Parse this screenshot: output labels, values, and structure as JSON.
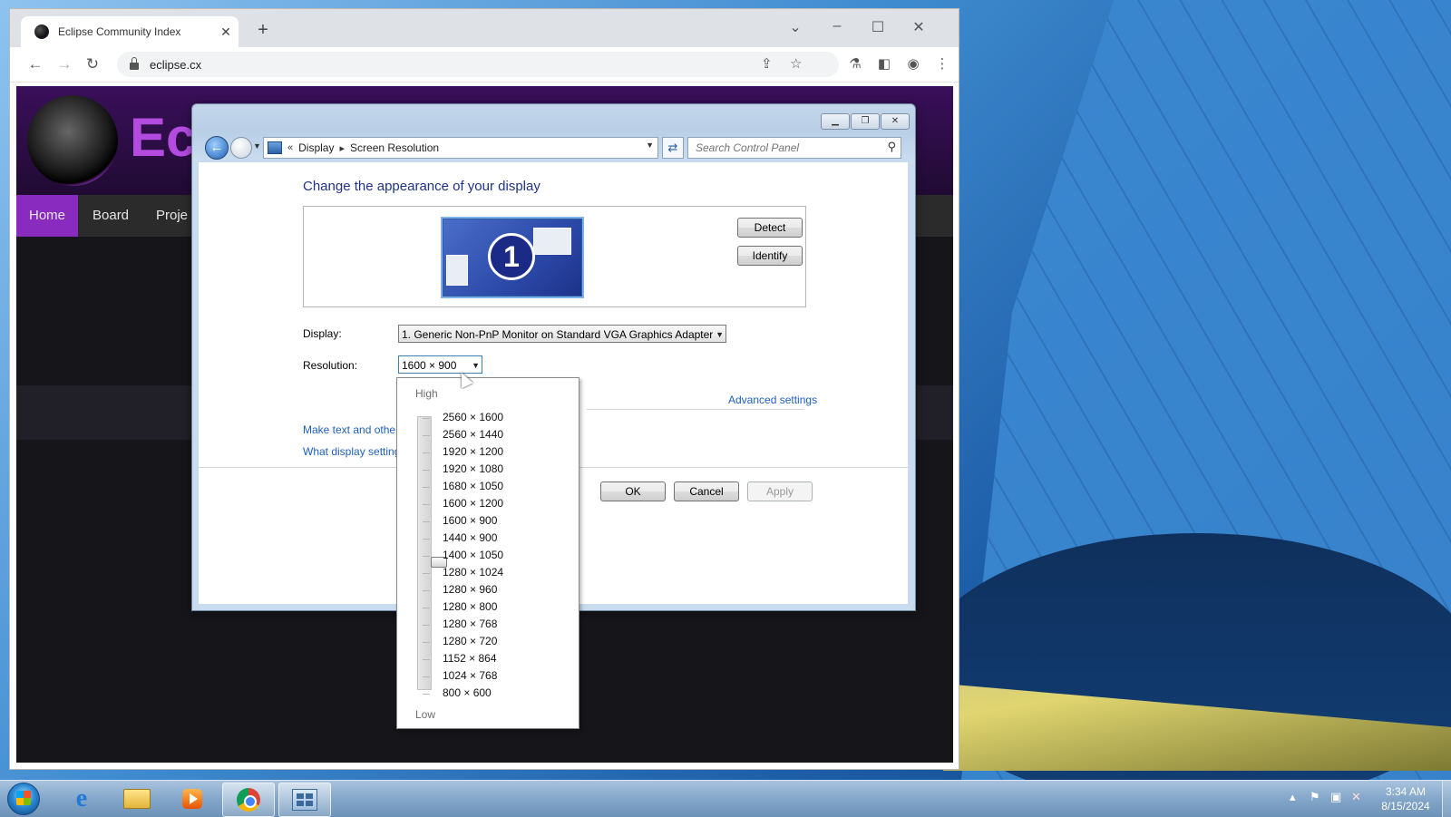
{
  "browser": {
    "tab_title": "Eclipse Community Index",
    "tab_close": "✕",
    "new_tab": "+",
    "url": "eclipse.cx",
    "window_controls": {
      "chevron": "⌄",
      "minimize": "–",
      "maximize": "☐",
      "close": "✕"
    }
  },
  "website": {
    "logo_text": "Ec",
    "nav": [
      "Home",
      "Board",
      "Proje"
    ],
    "active_nav": "Home"
  },
  "control_panel": {
    "breadcrumb": [
      "Display",
      "Screen Resolution"
    ],
    "breadcrumb_prefix": "«",
    "search_placeholder": "Search Control Panel",
    "heading": "Change the appearance of your display",
    "monitor_number": "1",
    "detect_label": "Detect",
    "identify_label": "Identify",
    "display_label": "Display:",
    "display_value": "1. Generic Non-PnP Monitor on Standard VGA Graphics Adapter",
    "resolution_label": "Resolution:",
    "resolution_value": "1600 × 900",
    "advanced_settings": "Advanced settings",
    "link_text_size": "Make text and other",
    "link_display_settings": "What display setting",
    "ok_label": "OK",
    "cancel_label": "Cancel",
    "apply_label": "Apply"
  },
  "resolution_dropdown": {
    "high_label": "High",
    "low_label": "Low",
    "options": [
      "2560 × 1600",
      "2560 × 1440",
      "1920 × 1200",
      "1920 × 1080",
      "1680 × 1050",
      "1600 × 1200",
      "1600 × 900",
      "1440 × 900",
      "1400 × 1050",
      "1280 × 1024",
      "1280 × 960",
      "1280 × 800",
      "1280 × 768",
      "1280 × 720",
      "1152 × 864",
      "1024 × 768",
      "800 × 600"
    ],
    "selected": "1600 × 900"
  },
  "taskbar": {
    "time": "3:34 AM",
    "date": "8/15/2024",
    "apps": [
      "internet-explorer",
      "file-explorer",
      "media-player",
      "chrome",
      "control-panel"
    ],
    "running": [
      "chrome",
      "control-panel"
    ]
  },
  "colors": {
    "accent_purple": "#8a2bbf",
    "link_blue": "#1e5fbd",
    "heading_blue": "#1e3287"
  }
}
